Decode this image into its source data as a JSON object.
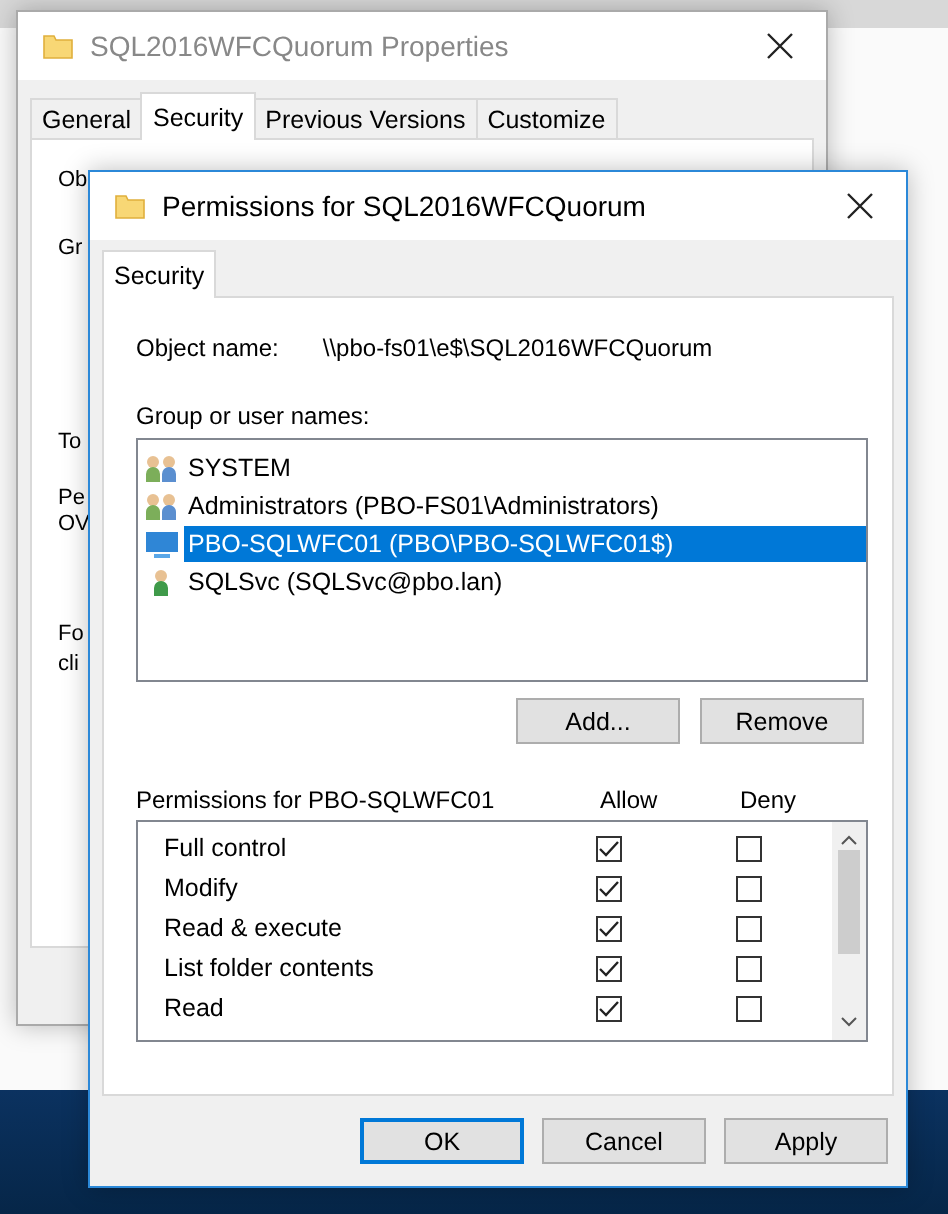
{
  "background_window": {
    "title": "SQL2016WFCQuorum Properties",
    "tabs": [
      {
        "label": "General",
        "selected": false
      },
      {
        "label": "Security",
        "selected": true
      },
      {
        "label": "Previous Versions",
        "selected": false
      },
      {
        "label": "Customize",
        "selected": false
      }
    ],
    "cut_labels": [
      "Ob",
      "Gr",
      "To",
      "Pe",
      "OV",
      "Fo",
      "cli"
    ]
  },
  "dialog": {
    "title": "Permissions for SQL2016WFCQuorum",
    "tabs": [
      {
        "label": "Security",
        "selected": true
      }
    ],
    "object_name_label": "Object name:",
    "object_name": "\\\\pbo-fs01\\e$\\SQL2016WFCQuorum",
    "group_label": "Group or user names:",
    "principals": [
      {
        "name": "SYSTEM",
        "kind": "group",
        "selected": false
      },
      {
        "name": "Administrators (PBO-FS01\\Administrators)",
        "kind": "group",
        "selected": false
      },
      {
        "name": "PBO-SQLWFC01 (PBO\\PBO-SQLWFC01$)",
        "kind": "computer",
        "selected": true
      },
      {
        "name": "SQLSvc (SQLSvc@pbo.lan)",
        "kind": "user",
        "selected": false
      }
    ],
    "principal_buttons": [
      "Add...",
      "Remove"
    ],
    "permissions_label": "Permissions for PBO-SQLWFC01",
    "columns": [
      "Allow",
      "Deny"
    ],
    "permissions": [
      {
        "name": "Full control",
        "allow": true,
        "deny": false
      },
      {
        "name": "Modify",
        "allow": true,
        "deny": false
      },
      {
        "name": "Read & execute",
        "allow": true,
        "deny": false
      },
      {
        "name": "List folder contents",
        "allow": true,
        "deny": false
      },
      {
        "name": "Read",
        "allow": true,
        "deny": false
      }
    ],
    "buttons": [
      {
        "label": "OK",
        "default": true
      },
      {
        "label": "Cancel",
        "default": false
      },
      {
        "label": "Apply",
        "default": false
      }
    ]
  }
}
